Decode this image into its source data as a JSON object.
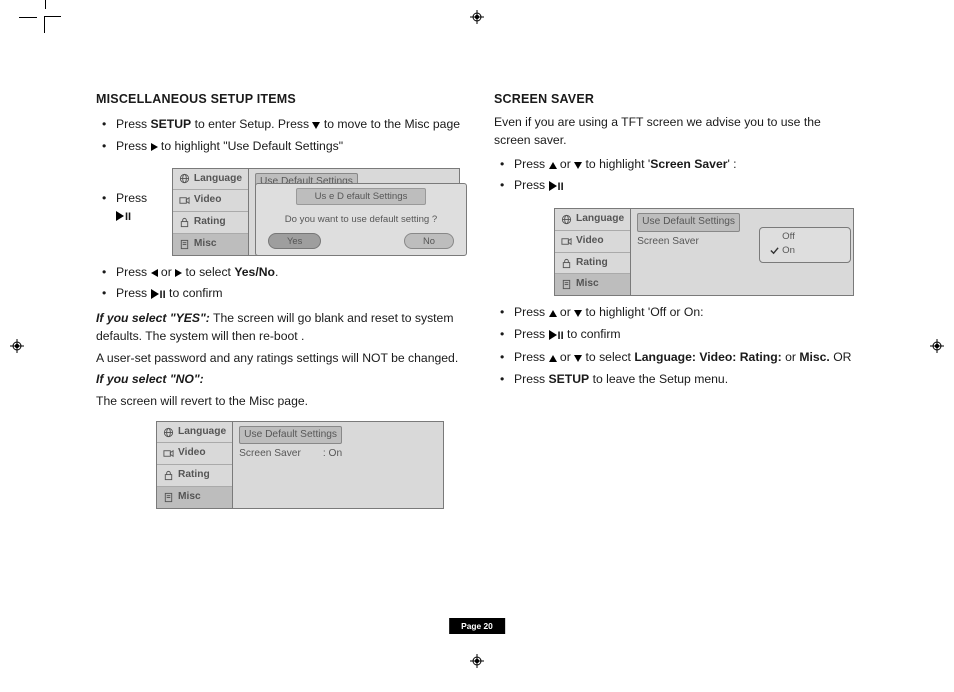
{
  "page_label": "Page 20",
  "left": {
    "heading": "MISCELLANEOUS SETUP ITEMS",
    "b1_a": "Press ",
    "b1_setup": "SETUP",
    "b1_b": " to enter Setup. Press ",
    "b1_c": "  to move to the Misc page",
    "b2_a": "Press ",
    "b2_b": " to highlight ",
    "b2_q": "\"Use Default Settings\"",
    "b3_a": "Press ",
    "b4_a": "Press ",
    "b4_b": " or ",
    "b4_c": " to select ",
    "b4_yesno": "Yes/No",
    "b4_d": ".",
    "b5_a": "Press ",
    "b5_b": " to confirm",
    "yes_label": "If you select \"YES\":",
    "yes_text": "  The screen will go blank and reset to system defaults. The system will then re-boot .",
    "pwd_note": "A user-set password and any ratings settings will NOT be changed.",
    "no_label": "If you select \"NO\":",
    "no_text": "The screen will revert to the Misc page."
  },
  "right": {
    "heading": "SCREEN SAVER",
    "intro": "Even if you are using a TFT screen we advise you to use the screen saver.",
    "b1_a": "Press ",
    "b1_b": " or ",
    "b1_c": "  to highlight '",
    "b1_ss": "Screen Saver",
    "b1_d": "' :",
    "b2_a": "Press ",
    "b3_a": "Press ",
    "b3_b": " or ",
    "b3_c": "  to highlight 'Off or On:",
    "b4_a": "Press ",
    "b4_b": " to confirm",
    "b5_a": "Press ",
    "b5_b": " or ",
    "b5_c": "  to select ",
    "b5_opts": "Language: Video: Rating:",
    "b5_d": " or ",
    "b5_misc": "Misc.",
    "b5_e": "  OR",
    "b6_a": "Press ",
    "b6_setup": "SETUP",
    "b6_b": " to leave the Setup menu."
  },
  "osd": {
    "tabs": {
      "language": "Language",
      "video": "Video",
      "rating": "Rating",
      "misc": "Misc"
    },
    "use_default": "Use Default Settings",
    "screen_saver": "Screen Saver",
    "on": ": On",
    "dlg_title": "Us e D efault  Settings",
    "dlg_q": "Do you want to use default setting ?",
    "yes": "Yes",
    "no": "No",
    "off": "Off",
    "on_plain": "On"
  }
}
